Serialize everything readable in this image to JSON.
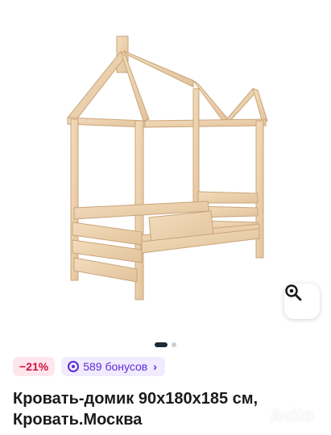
{
  "gallery": {
    "image_alt": "Кровать-домик",
    "slide_index": 1,
    "slide_count": 2
  },
  "icons": {
    "search": "magnifier-icon",
    "bonus": "bonus-coin-icon",
    "chevron": "chevron-right-icon"
  },
  "badges": {
    "discount": "−21%",
    "bonus": "589 бонусов",
    "bonus_chevron": "›"
  },
  "title": "Кровать-домик 90x180x185 см, Кровать.Москва",
  "watermark": "Avito",
  "colors": {
    "discount_bg": "#ffe6ec",
    "discount_text": "#d10e3e",
    "bonus_bg": "#f1ebff",
    "bonus_text": "#5b2bd9",
    "dot_active": "#1c2a39",
    "dot_inactive": "#c9cfd6"
  }
}
